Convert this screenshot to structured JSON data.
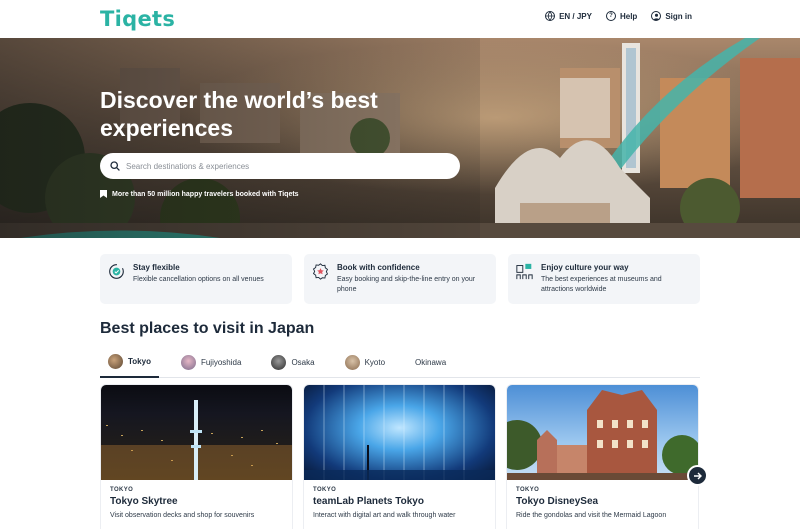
{
  "header": {
    "logo": "Tiqets",
    "language": "EN / JPY",
    "help": "Help",
    "signin": "Sign in"
  },
  "hero": {
    "title": "Discover the world’s best experiences",
    "search_placeholder": "Search destinations & experiences",
    "trust_text": "More than 50 million happy travelers booked with Tiqets"
  },
  "features": [
    {
      "title": "Stay flexible",
      "desc": "Flexible cancellation options on all venues",
      "icon": "flexible-icon"
    },
    {
      "title": "Book with confidence",
      "desc": "Easy booking and skip-the-line entry on your phone",
      "icon": "badge-icon"
    },
    {
      "title": "Enjoy culture your way",
      "desc": "The best experiences at museums and attractions worldwide",
      "icon": "culture-icon"
    }
  ],
  "section": {
    "title": "Best places to visit in Japan",
    "tabs": [
      {
        "label": "Tokyo",
        "active": true
      },
      {
        "label": "Fujiyoshida",
        "active": false
      },
      {
        "label": "Osaka",
        "active": false
      },
      {
        "label": "Kyoto",
        "active": false
      },
      {
        "label": "Okinawa",
        "active": false
      }
    ]
  },
  "cards": [
    {
      "city": "TOKYO",
      "name": "Tokyo Skytree",
      "desc": "Visit observation decks and shop for souvenirs"
    },
    {
      "city": "TOKYO",
      "name": "teamLab Planets Tokyo",
      "desc": "Interact with digital art and walk through water"
    },
    {
      "city": "TOKYO",
      "name": "Tokyo DisneySea",
      "desc": "Ride the gondolas and visit the Mermaid Lagoon"
    }
  ],
  "colors": {
    "brand": "#2bb3a4",
    "text": "#1d2a3a",
    "card_bg": "#f3f5f8"
  }
}
